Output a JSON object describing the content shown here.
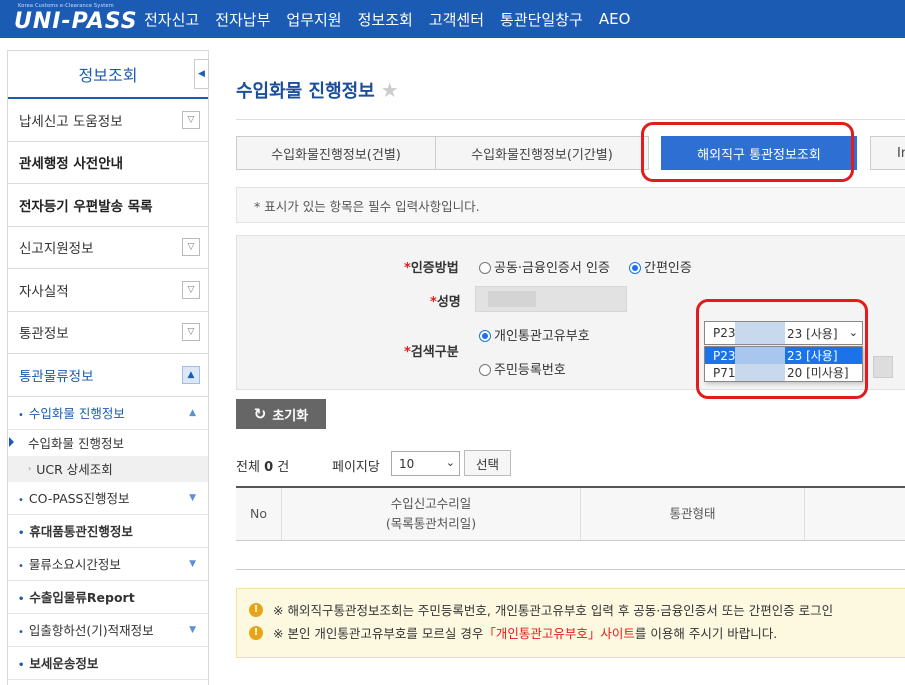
{
  "logo": {
    "tagline": "Korea Customs e-Clearance System",
    "name": "UNI-PASS"
  },
  "topnav": [
    "전자신고",
    "전자납부",
    "업무지원",
    "정보조회",
    "고객센터",
    "통관단일창구",
    "AEO"
  ],
  "sidebar": {
    "title": "정보조회",
    "items": [
      {
        "label": "납세신고 도움정보",
        "toggle": true
      },
      {
        "label": "관세행정 사전안내",
        "bold": true
      },
      {
        "label": "전자등기 우편발송 목록",
        "bold": true
      },
      {
        "label": "신고지원정보",
        "toggle": true
      },
      {
        "label": "자사실적",
        "toggle": true
      },
      {
        "label": "통관정보",
        "toggle": true
      },
      {
        "label": "통관물류정보",
        "toggle": true,
        "open": true
      }
    ],
    "sub": {
      "open_group": "수입화물 진행정보",
      "current": "수입화물 진행정보",
      "ucr": "UCR 상세조회",
      "rest": [
        {
          "label": "CO-PASS진행정보",
          "arrow": true
        },
        {
          "label": "휴대품통관진행정보",
          "bold": true
        },
        {
          "label": "물류소요시간정보",
          "arrow": true
        },
        {
          "label": "수출입물류Report",
          "bold": true
        },
        {
          "label": "입출항하선(기)적재정보",
          "arrow": true
        },
        {
          "label": "보세운송정보",
          "bold": true
        }
      ]
    }
  },
  "page": {
    "title": "수입화물 진행정보",
    "tabs": [
      "수입화물진행정보(건별)",
      "수입화물진행정보(기간별)",
      "해외직구 통관정보조회",
      "Impo"
    ],
    "notice": "* 표시가 있는 항목은 필수 입력사항입니다."
  },
  "form": {
    "auth_label": "인증방법",
    "auth_options": [
      "공동·금융인증서 인증",
      "간편인증"
    ],
    "name_label": "성명",
    "search_label": "검색구분",
    "search_options": [
      "개인통관고유부호",
      "주민등록번호"
    ],
    "select_value": {
      "prefix": "P23",
      "suffix": "23 [사용]"
    },
    "dropdown": [
      {
        "prefix": "P23",
        "suffix": "23 [사용]"
      },
      {
        "prefix": "P71",
        "suffix": "20 [미사용]"
      }
    ],
    "required_mark": "*"
  },
  "reset_button": "초기화",
  "results": {
    "total_label": "전체",
    "total_count": "0",
    "total_unit": "건",
    "per_page_label": "페이지당",
    "per_page_value": "10",
    "choose_button": "선택"
  },
  "grid": {
    "headers": [
      "No",
      "수입신고수리일\n(목록통관처리일)",
      "통관형태"
    ]
  },
  "warnings": [
    {
      "text": "※ 해외직구통관정보조회는 주민등록번호, 개인통관고유부호 입력 후 공동·금융인증서 또는 간편인증 로그인"
    },
    {
      "pre": "※ 본인 개인통관고유부호를 모르실 경우 ",
      "link": "「개인통관고유부호」사이트",
      "post": "를 이용해 주시기 바랍니다."
    }
  ],
  "colors": {
    "brand": "#1b5bb3",
    "active_tab": "#2d6fd2",
    "highlight": "#e21b1b",
    "warning": "#e8a317"
  }
}
